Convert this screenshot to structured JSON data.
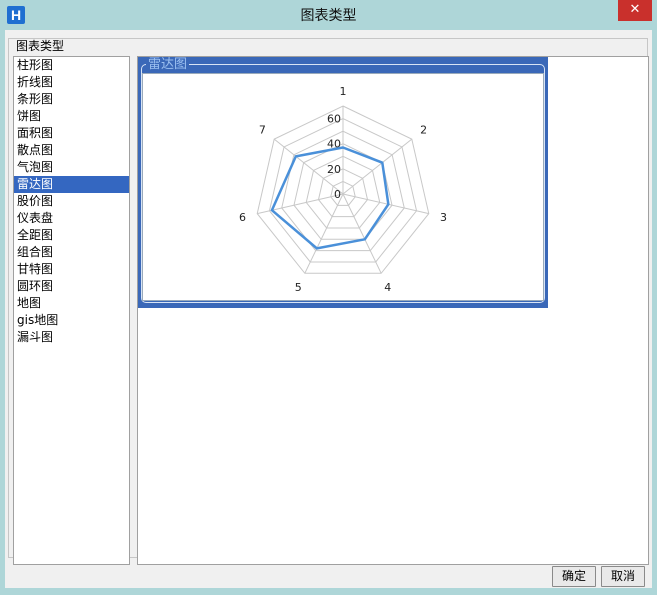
{
  "window": {
    "title": "图表类型",
    "close_glyph": "✕",
    "app_icon": "H"
  },
  "group_label": "图表类型",
  "chart_types": [
    "柱形图",
    "折线图",
    "条形图",
    "饼图",
    "面积图",
    "散点图",
    "气泡图",
    "雷达图",
    "股价图",
    "仪表盘",
    "全距图",
    "组合图",
    "甘特图",
    "圆环图",
    "地图",
    "gis地图",
    "漏斗图"
  ],
  "selected_index": 7,
  "preview": {
    "title": "雷达图"
  },
  "chart_data": {
    "type": "radar",
    "title": "",
    "categories": [
      "1",
      "2",
      "3",
      "4",
      "5",
      "6",
      "7"
    ],
    "rticks": [
      "0",
      "20",
      "40",
      "60"
    ],
    "rlim": [
      0,
      70
    ],
    "series": [
      {
        "values": [
          37,
          40,
          37,
          40,
          48,
          58,
          48
        ],
        "color": "#4a90d9"
      }
    ],
    "grid_color": "#c8c8c8"
  },
  "buttons": {
    "ok": "确定",
    "cancel": "取消"
  }
}
